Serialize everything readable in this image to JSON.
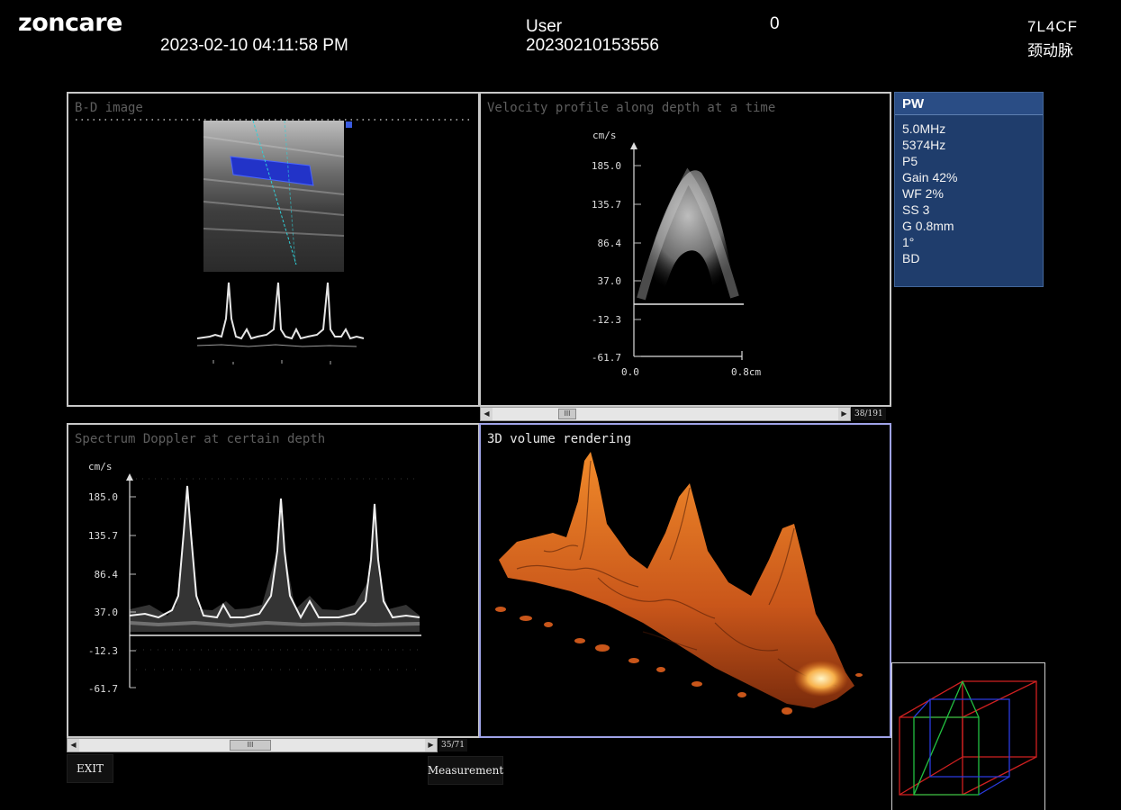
{
  "header": {
    "brand": "zoncare",
    "datetime": "2023-02-10 04:11:58 PM",
    "user_label": "User",
    "user_id": "20230210153556",
    "counter": "0",
    "probe": "7L4CF",
    "preset": "颈动脉"
  },
  "panels": {
    "bd_image": {
      "title": "B-D image"
    },
    "velocity_profile": {
      "title": "Velocity profile along depth at a time",
      "y_unit": "cm/s",
      "y_ticks": [
        "185.0",
        "135.7",
        "86.4",
        "37.0",
        "-12.3",
        "-61.7"
      ],
      "x_ticks": [
        "0.0",
        "0.8cm"
      ]
    },
    "spectrum": {
      "title": "Spectrum Doppler at certain depth",
      "y_unit": "cm/s",
      "y_ticks": [
        "185.0",
        "135.7",
        "86.4",
        "37.0",
        "-12.3",
        "-61.7"
      ]
    },
    "volume": {
      "title": "3D volume rendering"
    }
  },
  "info_panel": {
    "mode": "PW",
    "lines": [
      "5.0MHz",
      "5374Hz",
      "P5",
      "Gain 42%",
      "WF 2%",
      "SS 3",
      "G 0.8mm",
      "1°",
      "BD"
    ]
  },
  "scrollbars": {
    "upper": {
      "frame": "38/191",
      "thumb_glyph": "III"
    },
    "lower": {
      "frame": "35/71",
      "thumb_glyph": "III"
    }
  },
  "buttons": {
    "exit": "EXIT",
    "measurement": "Measurement"
  },
  "colors": {
    "doppler_box": "#1f3fd0",
    "volume_orange": "#e0701a",
    "info_bg": "#1f3d6c",
    "panel_border": "#c8c8c8",
    "active_border": "#9fa3e8"
  }
}
